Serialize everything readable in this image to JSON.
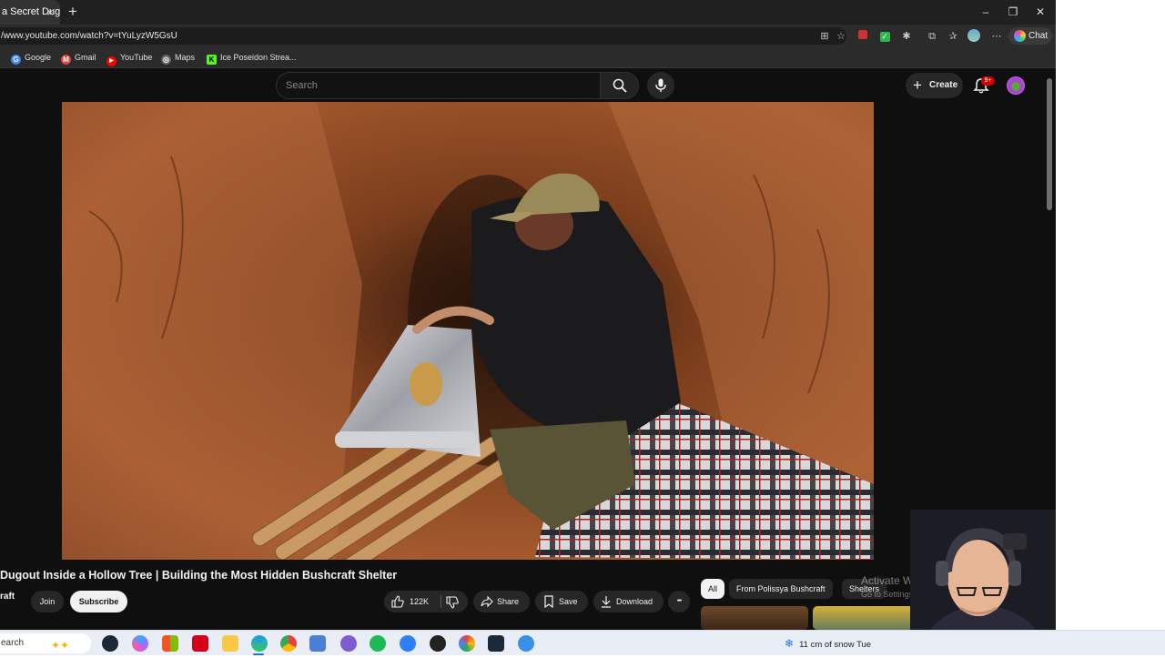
{
  "browser": {
    "tab_title": "a Secret Dugo",
    "tab_close": "×",
    "new_tab": "+",
    "window_controls": {
      "minimize": "–",
      "maximize": "❐",
      "close": "✕"
    },
    "url": "/www.youtube.com/watch?v=tYuLyzW5GsU",
    "chat_label": "Chat"
  },
  "bookmarks": [
    {
      "label": "Google",
      "color": "#4285f4",
      "glyph": "G"
    },
    {
      "label": "Gmail",
      "color": "#ea4335",
      "glyph": "M"
    },
    {
      "label": "YouTube",
      "color": "#ff0000",
      "glyph": "▶"
    },
    {
      "label": "Maps",
      "color": "#5f6368",
      "glyph": "◎"
    },
    {
      "label": "Ice Poseidon Strea...",
      "color": "#53fc18",
      "glyph": "K"
    }
  ],
  "youtube": {
    "search_placeholder": "Search",
    "create_label": "Create",
    "notification_count": "9+",
    "video": {
      "title": "Dugout Inside a Hollow Tree | Building the Most Hidden Bushcraft Shelter",
      "channel": "raft",
      "join_label": "Join",
      "subscribe_label": "Subscribe",
      "likes": "122K",
      "share_label": "Share",
      "save_label": "Save",
      "download_label": "Download",
      "more_label": "•••"
    },
    "chips": [
      {
        "label": "All",
        "active": true
      },
      {
        "label": "From Polissya Bushcraft",
        "active": false
      },
      {
        "label": "Shelters",
        "active": false
      }
    ]
  },
  "overlay": {
    "activate_windows_line1": "Activate Wind",
    "activate_windows_line2": "Go to Settings to a"
  },
  "taskbar": {
    "search_label": "earch",
    "weather_text": "11 cm of snow Tue",
    "weather_icon": "❄"
  }
}
